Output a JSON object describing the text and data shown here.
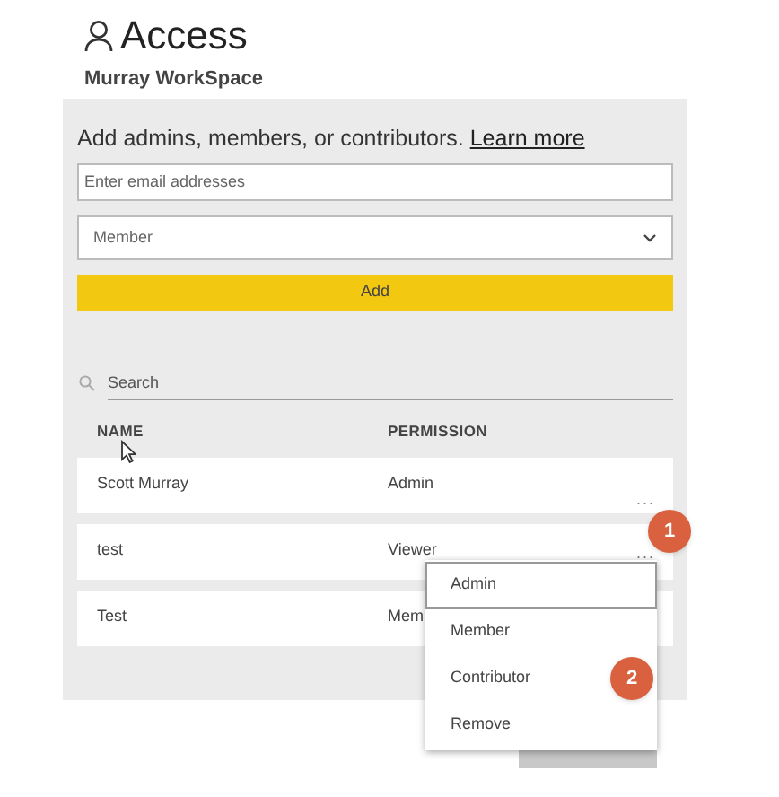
{
  "header": {
    "title": "Access",
    "subtitle": "Murray WorkSpace"
  },
  "add_section": {
    "prompt": "Add admins, members, or contributors.",
    "link": "Learn more",
    "email_placeholder": "Enter email addresses",
    "role": "Member",
    "add_button": "Add"
  },
  "search": {
    "placeholder": "Search"
  },
  "table": {
    "columns": [
      "NAME",
      "PERMISSION"
    ],
    "rows": [
      {
        "name": "Scott Murray",
        "permission": "Admin",
        "more": "..."
      },
      {
        "name": "test",
        "permission": "Viewer",
        "more": "..."
      },
      {
        "name": "Test",
        "permission": "Mem"
      }
    ]
  },
  "menu": {
    "items": [
      {
        "label": "Admin",
        "selected": true
      },
      {
        "label": "Member",
        "selected": false
      },
      {
        "label": "Contributor",
        "selected": false
      },
      {
        "label": "Remove",
        "selected": false
      }
    ]
  },
  "callouts": [
    "1",
    "2"
  ]
}
